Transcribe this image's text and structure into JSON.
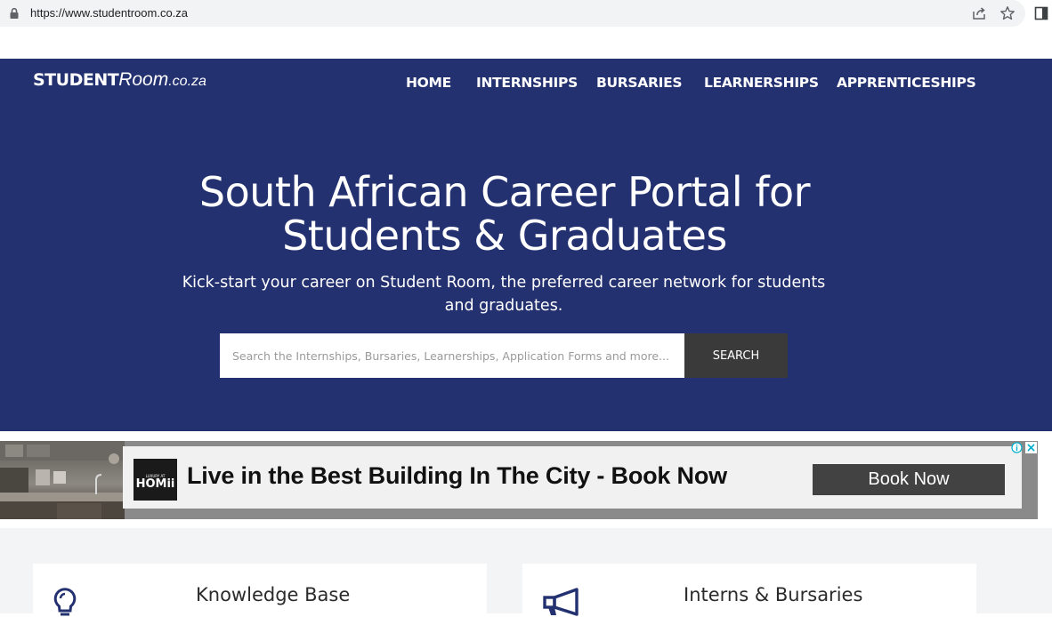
{
  "browser": {
    "url": "https://www.studentroom.co.za",
    "icons": [
      "lock-icon",
      "share-icon",
      "star-icon",
      "side-panel-icon"
    ]
  },
  "header": {
    "logo": {
      "bold": "STUDENT",
      "italic": "Room",
      "suffix": ".co.za"
    },
    "nav": [
      {
        "label": "HOME"
      },
      {
        "label": "INTERNSHIPS"
      },
      {
        "label": "BURSARIES"
      },
      {
        "label": "LEARNERSHIPS"
      },
      {
        "label": "APPRENTICESHIPS"
      }
    ]
  },
  "hero": {
    "title_line1": "South African Career Portal for",
    "title_line2": "Students & Graduates",
    "subtitle": "Kick-start your career on Student Room, the preferred career network for students and graduates.",
    "search": {
      "placeholder": "Search the Internships, Bursaries, Learnerships, Application Forms and more...",
      "value": "",
      "button_label": "SEARCH"
    }
  },
  "ad": {
    "logo_small": "LUXURY AT",
    "logo_brand": "HOMii",
    "headline": "Live in the Best Building In The City - Book Now",
    "cta": "Book Now",
    "icons": [
      "adchoices-icon",
      "close-icon"
    ]
  },
  "cards": [
    {
      "title": "Knowledge Base",
      "icon": "lightbulb-icon"
    },
    {
      "title": "Interns & Bursaries",
      "icon": "megaphone-icon"
    }
  ],
  "colors": {
    "hero_bg": "#243170",
    "search_button_bg": "#3a3a3a",
    "icon_navy": "#243170",
    "section_bg": "#f3f4f6"
  }
}
